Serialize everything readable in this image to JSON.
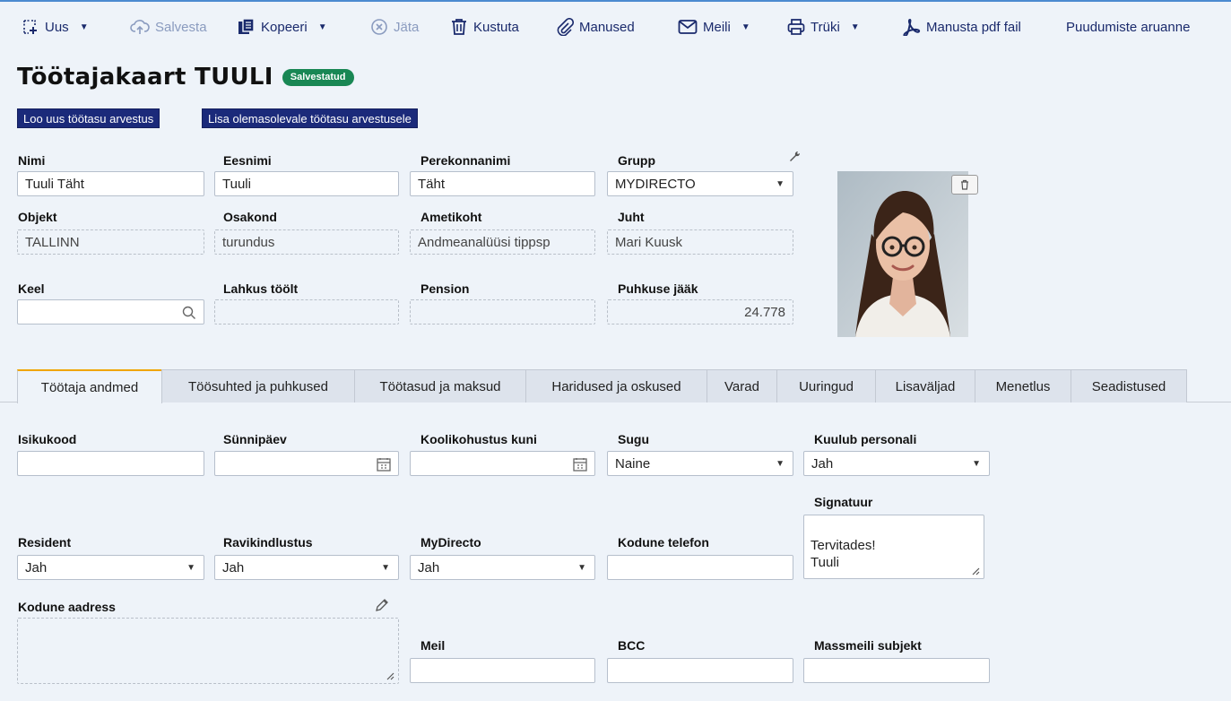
{
  "toolbar": {
    "new": "Uus",
    "save": "Salvesta",
    "copy": "Kopeeri",
    "skip": "Jäta",
    "delete": "Kustuta",
    "attachments": "Manused",
    "mail": "Meili",
    "print": "Trüki",
    "attach_pdf": "Manusta pdf fail",
    "absence_report": "Puudumiste aruanne"
  },
  "header": {
    "title": "Töötajakaart TUULI",
    "status": "Salvestatud"
  },
  "actions": {
    "new_payroll": "Loo uus töötasu arvestus",
    "add_to_payroll": "Lisa olemasolevale töötasu arvestusele"
  },
  "fields": {
    "name": {
      "label": "Nimi",
      "value": "Tuuli Täht"
    },
    "first_name": {
      "label": "Eesnimi",
      "value": "Tuuli"
    },
    "last_name": {
      "label": "Perekonnanimi",
      "value": "Täht"
    },
    "group": {
      "label": "Grupp",
      "value": "MYDIRECTO"
    },
    "object": {
      "label": "Objekt",
      "value": "TALLINN"
    },
    "department": {
      "label": "Osakond",
      "value": "turundus"
    },
    "position": {
      "label": "Ametikoht",
      "value": "Andmeanalüüsi tippsp"
    },
    "manager": {
      "label": "Juht",
      "value": "Mari Kuusk"
    },
    "language": {
      "label": "Keel",
      "value": ""
    },
    "left_work": {
      "label": "Lahkus töölt",
      "value": ""
    },
    "pension": {
      "label": "Pension",
      "value": ""
    },
    "vacation_balance": {
      "label": "Puhkuse jääk",
      "value": "24.778"
    }
  },
  "tabs": [
    {
      "label": "Töötaja andmed",
      "active": true
    },
    {
      "label": "Töösuhted ja puhkused"
    },
    {
      "label": "Töötasud ja maksud"
    },
    {
      "label": "Haridused ja oskused"
    },
    {
      "label": "Varad"
    },
    {
      "label": "Uuringud"
    },
    {
      "label": "Lisaväljad"
    },
    {
      "label": "Menetlus"
    },
    {
      "label": "Seadistused"
    }
  ],
  "details": {
    "id_code": {
      "label": "Isikukood",
      "value": ""
    },
    "birthday": {
      "label": "Sünnipäev",
      "value": ""
    },
    "school_until": {
      "label": "Koolikohustus kuni",
      "value": ""
    },
    "gender": {
      "label": "Sugu",
      "value": "Naine"
    },
    "staff": {
      "label": "Kuulub personali",
      "value": "Jah"
    },
    "signature": {
      "label": "Signatuur",
      "value": "Tervitades!\nTuuli"
    },
    "resident": {
      "label": "Resident",
      "value": "Jah"
    },
    "health_insurance": {
      "label": "Ravikindlustus",
      "value": "Jah"
    },
    "mydirecto": {
      "label": "MyDirecto",
      "value": "Jah"
    },
    "home_phone": {
      "label": "Kodune telefon",
      "value": ""
    },
    "home_address": {
      "label": "Kodune aadress",
      "value": ""
    },
    "email": {
      "label": "Meil",
      "value": ""
    },
    "bcc": {
      "label": "BCC",
      "value": ""
    },
    "mass_mail_subject": {
      "label": "Massmeili subjekt",
      "value": ""
    }
  },
  "colors": {
    "accent": "#1b2a7a",
    "status": "#198754",
    "active_tab": "#f0a500"
  }
}
